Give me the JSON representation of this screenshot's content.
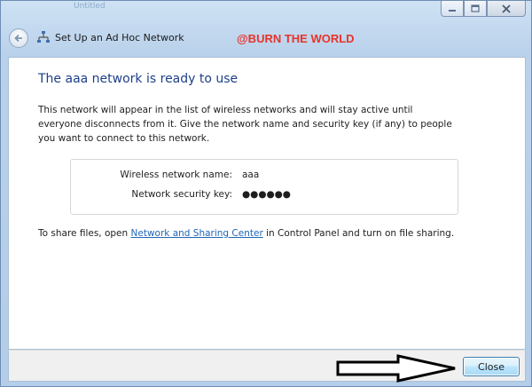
{
  "titlebar": {
    "ghost_text": "Untitled"
  },
  "window_controls": {
    "minimize_icon": "minimize-icon",
    "maximize_icon": "maximize-icon",
    "close_icon": "close-icon"
  },
  "header": {
    "wizard_title": "Set Up an Ad Hoc Network",
    "watermark": "@BURN THE WORLD"
  },
  "main": {
    "heading": "The aaa network is ready to use",
    "description": "This network will appear in the list of wireless networks and will stay active until everyone disconnects from it. Give the network name and security key (if any) to people you want to connect to this network.",
    "network_name_label": "Wireless network name:",
    "network_name_value": "aaa",
    "security_key_label": "Network security key:",
    "security_key_value": "●●●●●●",
    "share_prefix": "To share files, open ",
    "share_link": "Network and Sharing Center",
    "share_suffix": " in Control Panel and turn on file sharing."
  },
  "footer": {
    "close_label": "Close"
  },
  "colors": {
    "heading": "#1e3f8a",
    "link": "#2266b8",
    "watermark": "#e8332a",
    "chrome": "#b9d1ea"
  }
}
